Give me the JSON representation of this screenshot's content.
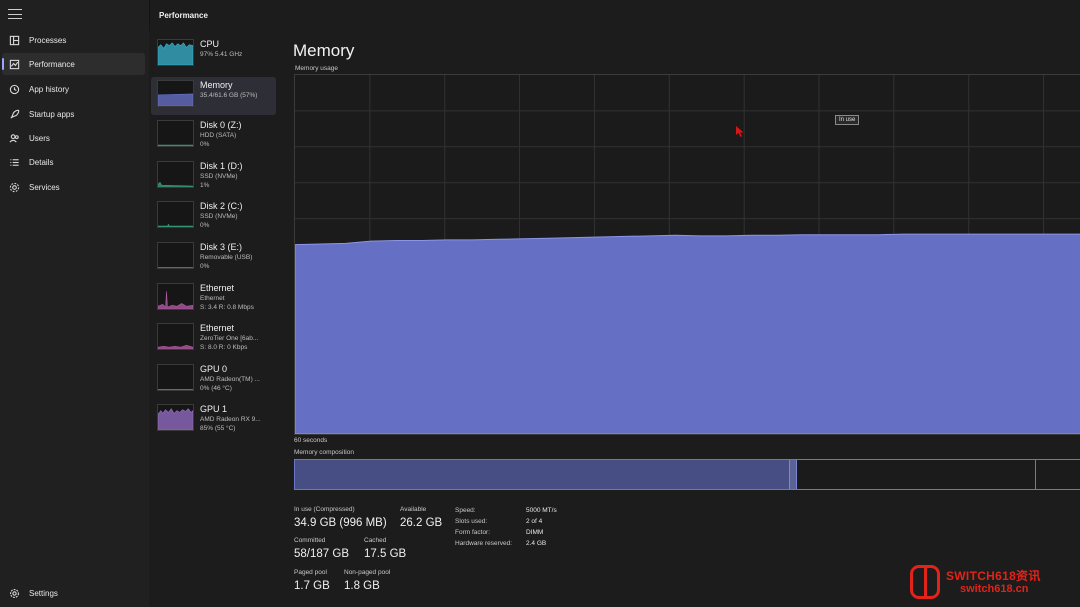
{
  "header": {
    "title": "Performance"
  },
  "nav": {
    "items": [
      {
        "label": "Processes",
        "icon": "processes-icon"
      },
      {
        "label": "Performance",
        "icon": "performance-icon",
        "active": true
      },
      {
        "label": "App history",
        "icon": "history-icon"
      },
      {
        "label": "Startup apps",
        "icon": "startup-icon"
      },
      {
        "label": "Users",
        "icon": "users-icon"
      },
      {
        "label": "Details",
        "icon": "details-icon"
      },
      {
        "label": "Services",
        "icon": "services-icon"
      }
    ],
    "settings": {
      "label": "Settings",
      "icon": "gear-icon"
    }
  },
  "devices": [
    {
      "name": "CPU",
      "line1": "97%  5.41 GHz",
      "line2": "",
      "color": "#3ab4d0"
    },
    {
      "name": "Memory",
      "line1": "35.4/61.6 GB (57%)",
      "line2": "",
      "color": "#6b75cf",
      "active": true
    },
    {
      "name": "Disk 0 (Z:)",
      "line1": "HDD (SATA)",
      "line2": "0%",
      "color": "#3aa37a"
    },
    {
      "name": "Disk 1 (D:)",
      "line1": "SSD (NVMe)",
      "line2": "1%",
      "color": "#3aa37a"
    },
    {
      "name": "Disk 2 (C:)",
      "line1": "SSD (NVMe)",
      "line2": "0%",
      "color": "#3aa37a"
    },
    {
      "name": "Disk 3 (E:)",
      "line1": "Removable (USB)",
      "line2": "0%",
      "color": "#3aa37a"
    },
    {
      "name": "Ethernet",
      "line1": "Ethernet",
      "line2": "S: 3.4  R: 0.8 Mbps",
      "color": "#b85ea8"
    },
    {
      "name": "Ethernet",
      "line1": "ZeroTier One [6ab...",
      "line2": "S: 8.0  R: 0 Kbps",
      "color": "#b85ea8"
    },
    {
      "name": "GPU 0",
      "line1": "AMD Radeon(TM) ...",
      "line2": "0%  (46 °C)",
      "color": "#9a6fc9"
    },
    {
      "name": "GPU 1",
      "line1": "AMD Radeon RX 9...",
      "line2": "85%  (55 °C)",
      "color": "#9a6fc9"
    }
  ],
  "main": {
    "title": "Memory",
    "usage_label": "Memory usage",
    "tooltip": "In use",
    "time_label": "60 seconds",
    "composition_label": "Memory composition",
    "graph_color": "#6570c4"
  },
  "chart_data": {
    "type": "area",
    "title": "Memory usage",
    "xlabel": "60 seconds",
    "ylabel": "",
    "ylim": [
      0,
      61.6
    ],
    "series": [
      {
        "name": "In use",
        "values": [
          32.5,
          32.6,
          32.7,
          33.1,
          33.2,
          33.2,
          33.3,
          33.3,
          33.4,
          33.5,
          33.6,
          33.7,
          33.8,
          33.9,
          34.0,
          34.1,
          34.0,
          34.0,
          34.1,
          34.1,
          34.2,
          34.2,
          34.2,
          34.2,
          34.3,
          34.3,
          34.3,
          34.3,
          34.3,
          34.3,
          34.3,
          34.3
        ]
      }
    ]
  },
  "composition": {
    "in_use_fraction": 0.628,
    "modified_fraction": 0.01,
    "standby_end_fraction": 0.942
  },
  "stats": {
    "in_use_label": "In use (Compressed)",
    "in_use_value": "34.9 GB (996 MB)",
    "available_label": "Available",
    "available_value": "26.2 GB",
    "committed_label": "Committed",
    "committed_value": "58/187 GB",
    "cached_label": "Cached",
    "cached_value": "17.5 GB",
    "paged_label": "Paged pool",
    "paged_value": "1.7 GB",
    "nonpaged_label": "Non-paged pool",
    "nonpaged_value": "1.8 GB"
  },
  "details": [
    {
      "label": "Speed:",
      "value": "5000 MT/s"
    },
    {
      "label": "Slots used:",
      "value": "2 of 4"
    },
    {
      "label": "Form factor:",
      "value": "DIMM"
    },
    {
      "label": "Hardware reserved:",
      "value": "2.4 GB"
    }
  ],
  "watermark": {
    "line1": "SWITCH618资讯",
    "line2": "switch618.cn"
  }
}
